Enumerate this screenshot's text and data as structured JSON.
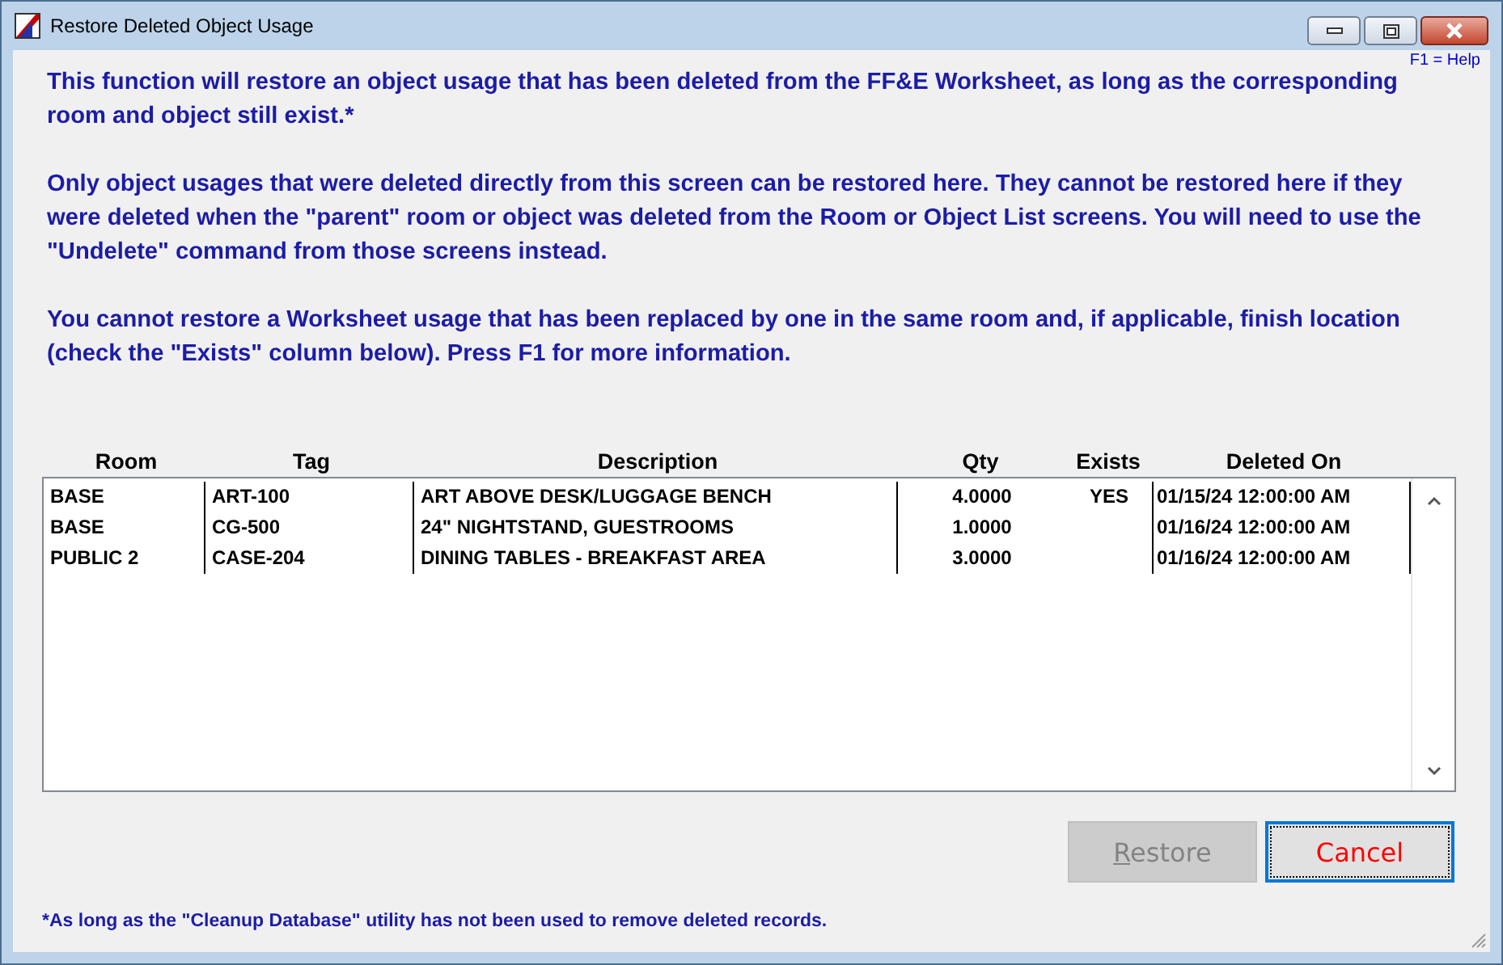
{
  "window": {
    "title": "Restore Deleted Object Usage"
  },
  "help_hint": "F1 = Help",
  "paragraphs": [
    "This function will restore an object usage that has been deleted from the FF&E Worksheet, as long as the corresponding room and object still exist.*",
    "Only object usages that were deleted directly from this screen can be restored here. They cannot be restored here if they were deleted when the \"parent\" room or object was deleted from the Room or Object List screens. You will need to use the \"Undelete\" command from those screens instead.",
    "You cannot restore a Worksheet usage that has been replaced by one in the same room and, if applicable, finish location (check the \"Exists\" column below). Press F1 for more information."
  ],
  "table": {
    "columns": [
      "Room",
      "Tag",
      "Description",
      "Qty",
      "Exists",
      "Deleted On"
    ],
    "rows": [
      [
        "BASE",
        "ART-100",
        "ART ABOVE DESK/LUGGAGE BENCH",
        "4.0000",
        "YES",
        "01/15/24 12:00:00 AM"
      ],
      [
        "BASE",
        "CG-500",
        "24\" NIGHTSTAND, GUESTROOMS",
        "1.0000",
        "",
        "01/16/24 12:00:00 AM"
      ],
      [
        "PUBLIC 2",
        "CASE-204",
        "DINING TABLES - BREAKFAST AREA",
        "3.0000",
        "",
        "01/16/24 12:00:00 AM"
      ]
    ]
  },
  "buttons": [
    {
      "label": "Restore",
      "disabled": true,
      "focused": false,
      "kind": "default"
    },
    {
      "label": "Cancel",
      "disabled": false,
      "focused": true,
      "kind": "cancel"
    }
  ],
  "footnote": "*As long as the \"Cleanup Database\" utility has not been used to remove deleted records."
}
